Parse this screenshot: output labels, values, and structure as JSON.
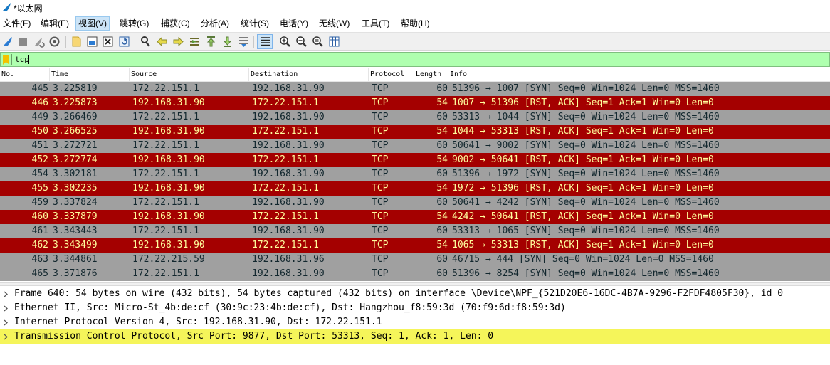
{
  "window": {
    "title": "*以太网"
  },
  "menu": [
    "文件(F)",
    "编辑(E)",
    "视图(V)",
    "跳转(G)",
    "捕获(C)",
    "分析(A)",
    "统计(S)",
    "电话(Y)",
    "无线(W)",
    "工具(T)",
    "帮助(H)"
  ],
  "menu_active": "视图(V)",
  "filter": {
    "value": "tcp",
    "background": "#afffaf"
  },
  "columns": {
    "no": "No.",
    "time": "Time",
    "source": "Source",
    "destination": "Destination",
    "protocol": "Protocol",
    "length": "Length",
    "info": "Info"
  },
  "colors": {
    "syn_bg": "#a0a0a0",
    "syn_fg": "#12272e",
    "rst_bg": "#a40000",
    "rst_fg": "#fffc9c",
    "selected_detail": "#f5f55a"
  },
  "packets": [
    {
      "no": "445",
      "time": "3.225819",
      "src": "172.22.151.1",
      "dst": "192.168.31.90",
      "proto": "TCP",
      "len": "60",
      "info": "51396 → 1007 [SYN] Seq=0 Win=1024 Len=0 MSS=1460",
      "kind": "syn"
    },
    {
      "no": "446",
      "time": "3.225873",
      "src": "192.168.31.90",
      "dst": "172.22.151.1",
      "proto": "TCP",
      "len": "54",
      "info": "1007 → 51396 [RST, ACK] Seq=1 Ack=1 Win=0 Len=0",
      "kind": "rst"
    },
    {
      "no": "449",
      "time": "3.266469",
      "src": "172.22.151.1",
      "dst": "192.168.31.90",
      "proto": "TCP",
      "len": "60",
      "info": "53313 → 1044 [SYN] Seq=0 Win=1024 Len=0 MSS=1460",
      "kind": "syn"
    },
    {
      "no": "450",
      "time": "3.266525",
      "src": "192.168.31.90",
      "dst": "172.22.151.1",
      "proto": "TCP",
      "len": "54",
      "info": "1044 → 53313 [RST, ACK] Seq=1 Ack=1 Win=0 Len=0",
      "kind": "rst"
    },
    {
      "no": "451",
      "time": "3.272721",
      "src": "172.22.151.1",
      "dst": "192.168.31.90",
      "proto": "TCP",
      "len": "60",
      "info": "50641 → 9002 [SYN] Seq=0 Win=1024 Len=0 MSS=1460",
      "kind": "syn"
    },
    {
      "no": "452",
      "time": "3.272774",
      "src": "192.168.31.90",
      "dst": "172.22.151.1",
      "proto": "TCP",
      "len": "54",
      "info": "9002 → 50641 [RST, ACK] Seq=1 Ack=1 Win=0 Len=0",
      "kind": "rst"
    },
    {
      "no": "454",
      "time": "3.302181",
      "src": "172.22.151.1",
      "dst": "192.168.31.90",
      "proto": "TCP",
      "len": "60",
      "info": "51396 → 1972 [SYN] Seq=0 Win=1024 Len=0 MSS=1460",
      "kind": "syn"
    },
    {
      "no": "455",
      "time": "3.302235",
      "src": "192.168.31.90",
      "dst": "172.22.151.1",
      "proto": "TCP",
      "len": "54",
      "info": "1972 → 51396 [RST, ACK] Seq=1 Ack=1 Win=0 Len=0",
      "kind": "rst"
    },
    {
      "no": "459",
      "time": "3.337824",
      "src": "172.22.151.1",
      "dst": "192.168.31.90",
      "proto": "TCP",
      "len": "60",
      "info": "50641 → 4242 [SYN] Seq=0 Win=1024 Len=0 MSS=1460",
      "kind": "syn"
    },
    {
      "no": "460",
      "time": "3.337879",
      "src": "192.168.31.90",
      "dst": "172.22.151.1",
      "proto": "TCP",
      "len": "54",
      "info": "4242 → 50641 [RST, ACK] Seq=1 Ack=1 Win=0 Len=0",
      "kind": "rst"
    },
    {
      "no": "461",
      "time": "3.343443",
      "src": "172.22.151.1",
      "dst": "192.168.31.90",
      "proto": "TCP",
      "len": "60",
      "info": "53313 → 1065 [SYN] Seq=0 Win=1024 Len=0 MSS=1460",
      "kind": "syn"
    },
    {
      "no": "462",
      "time": "3.343499",
      "src": "192.168.31.90",
      "dst": "172.22.151.1",
      "proto": "TCP",
      "len": "54",
      "info": "1065 → 53313 [RST, ACK] Seq=1 Ack=1 Win=0 Len=0",
      "kind": "rst"
    },
    {
      "no": "463",
      "time": "3.344861",
      "src": "172.22.215.59",
      "dst": "192.168.31.96",
      "proto": "TCP",
      "len": "60",
      "info": "46715 → 444 [SYN] Seq=0 Win=1024 Len=0 MSS=1460",
      "kind": "syn"
    },
    {
      "no": "465",
      "time": "3.371876",
      "src": "172.22.151.1",
      "dst": "192.168.31.90",
      "proto": "TCP",
      "len": "60",
      "info": "51396 → 8254 [SYN] Seq=0 Win=1024 Len=0 MSS=1460",
      "kind": "syn"
    }
  ],
  "details": [
    {
      "text": "Frame 640: 54 bytes on wire (432 bits), 54 bytes captured (432 bits) on interface \\Device\\NPF_{521D20E6-16DC-4B7A-9296-F2FDF4805F30}, id 0",
      "selected": false
    },
    {
      "text": "Ethernet II, Src: Micro-St_4b:de:cf (30:9c:23:4b:de:cf), Dst: Hangzhou_f8:59:3d (70:f9:6d:f8:59:3d)",
      "selected": false
    },
    {
      "text": "Internet Protocol Version 4, Src: 192.168.31.90, Dst: 172.22.151.1",
      "selected": false
    },
    {
      "text": "Transmission Control Protocol, Src Port: 9877, Dst Port: 53313, Seq: 1, Ack: 1, Len: 0",
      "selected": true
    }
  ]
}
